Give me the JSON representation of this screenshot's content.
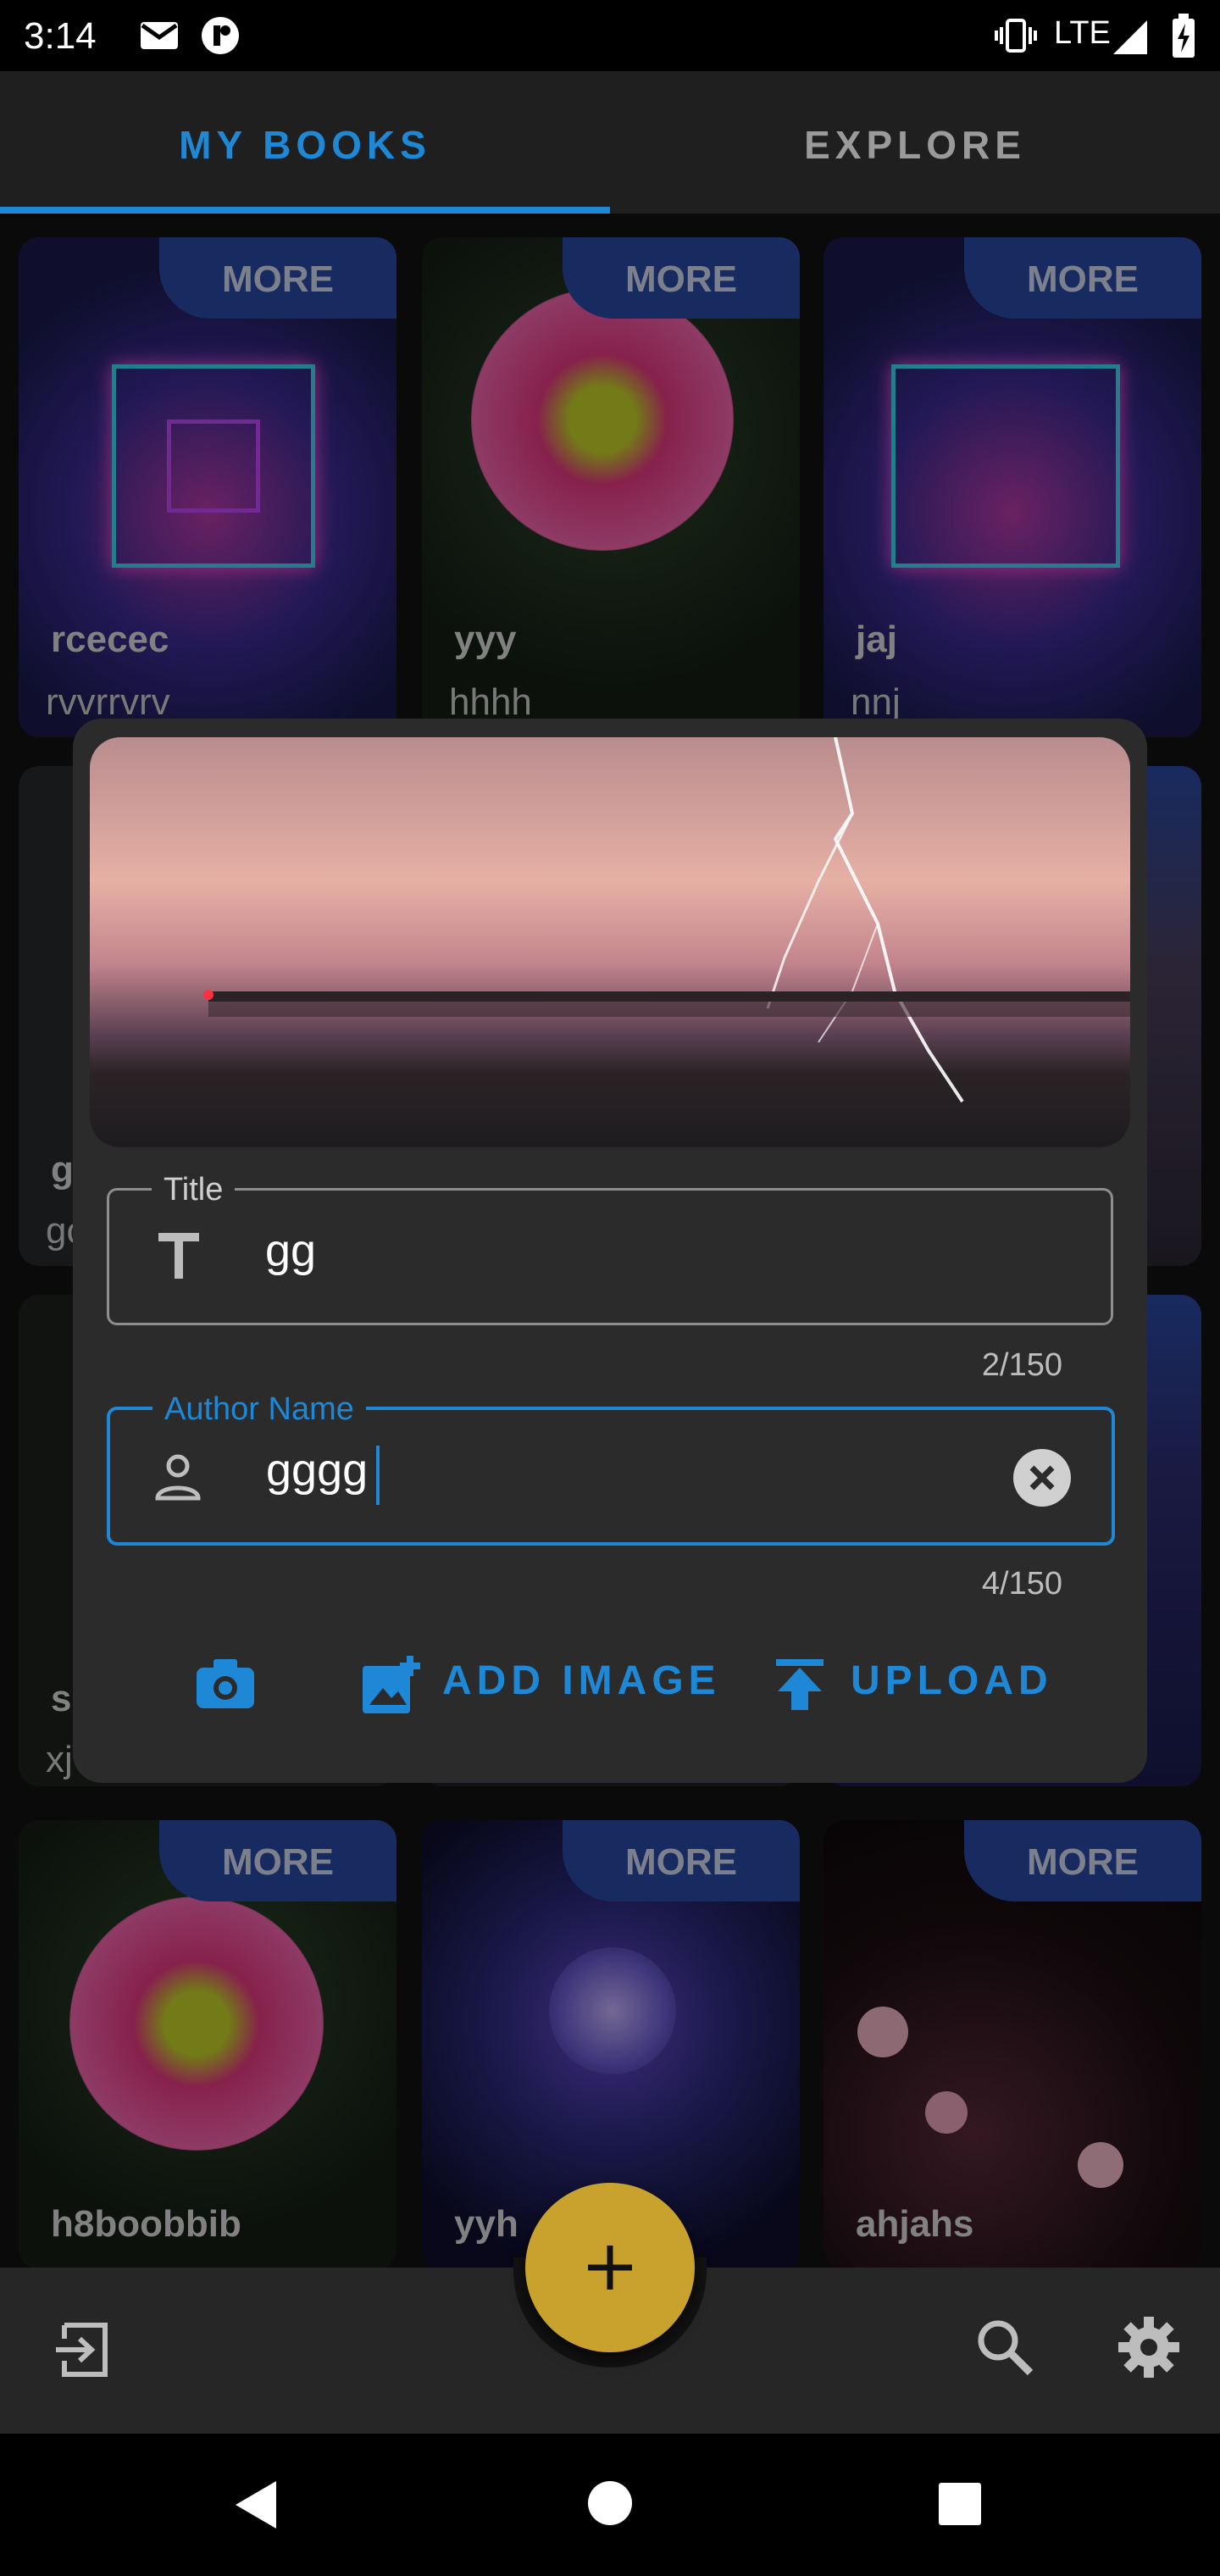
{
  "status_bar": {
    "time": "3:14",
    "network": "LTE"
  },
  "tabs": [
    {
      "label": "MY BOOKS",
      "selected": true
    },
    {
      "label": "EXPLORE",
      "selected": false
    }
  ],
  "more_label": "MORE",
  "books": [
    {
      "title": "rcecec",
      "author": "rvvrrvrv"
    },
    {
      "title": "yyy",
      "author": "hhhh"
    },
    {
      "title": "jaj",
      "author": "nnj"
    },
    {
      "title": "g",
      "author": "gc"
    },
    {
      "title": "s",
      "author": "xj"
    },
    {
      "title": "h8boobbib",
      "author": ""
    },
    {
      "title": "yyh",
      "author": ""
    },
    {
      "title": "ahjahs",
      "author": ""
    }
  ],
  "dialog": {
    "title_field": {
      "label": "Title",
      "value": "gg",
      "counter": "2/150"
    },
    "author_field": {
      "label": "Author Name",
      "value": "gggg",
      "counter": "4/150"
    },
    "actions": {
      "camera_icon": "camera-icon",
      "add_image": "ADD IMAGE",
      "upload": "UPLOAD"
    }
  },
  "bottom_bar": {
    "fab_label": "+",
    "icons": [
      "logout-icon",
      "search-icon",
      "settings-icon"
    ]
  },
  "colors": {
    "accent": "#1e88d6",
    "fab": "#c9a22e",
    "more_badge": "#2a4aa5",
    "dialog": "#2b2b2b"
  }
}
